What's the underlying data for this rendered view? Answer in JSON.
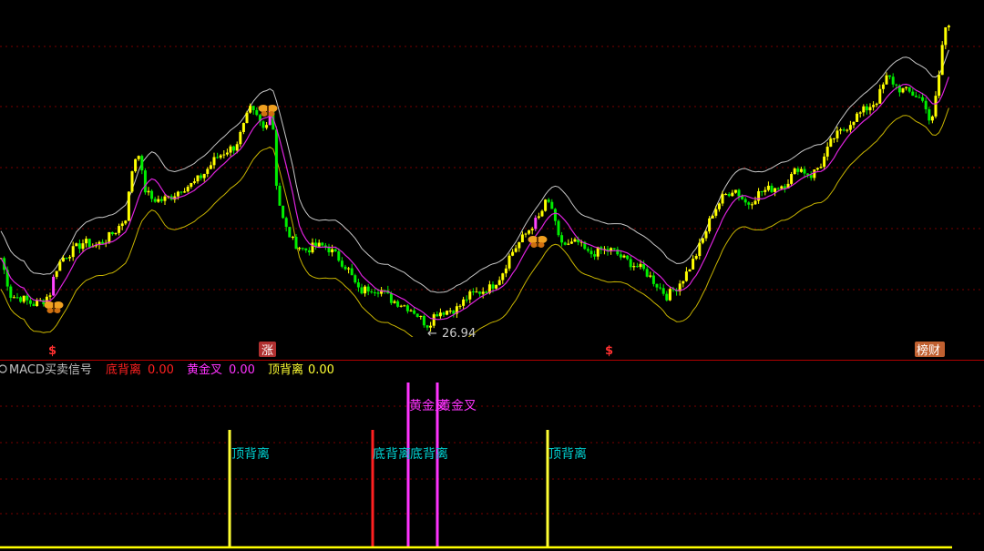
{
  "colors": {
    "background": "#000000",
    "rise": "#ffff00",
    "fall": "#00ee00",
    "signal_bar": "#ff44ff",
    "upper_band": "#c8c8c8",
    "mid_line": "#dd22dd",
    "lower_band": "#c8b400",
    "panel_divider": "#b00000",
    "grid": "#7a0000",
    "indicator_name": "#c0c0c0",
    "bottom_divergence": "#ff2020",
    "golden_cross": "#ff33ff",
    "top_divergence": "#ffff33",
    "bar_label": "#00d0d0",
    "marker_red": "#ff3030",
    "marker_badge_bg": "#b03030",
    "marker_badge_text": "#ffffff",
    "marker_right_bg": "#c06030"
  },
  "price_panel": {
    "low_callout": {
      "text": "26.94",
      "arrow": "←"
    },
    "butterfly_icon": "butterfly-icon",
    "markers": [
      {
        "text": "$",
        "style": "plain"
      },
      {
        "text": "涨",
        "style": "badge"
      },
      {
        "text": "$",
        "style": "plain"
      },
      {
        "text": "榜财",
        "style": "badge-right"
      }
    ]
  },
  "indicator_panel": {
    "name": "MACD买卖信号",
    "legend": [
      {
        "label": "底背离",
        "value": "0.00",
        "color": "#ff2020"
      },
      {
        "label": "黄金叉",
        "value": "0.00",
        "color": "#ff33ff"
      },
      {
        "label": "顶背离",
        "value": "0.00",
        "color": "#ffff33"
      }
    ],
    "signal_labels": [
      "顶背离",
      "底背离",
      "黄金叉",
      "底背离",
      "黄金叉",
      "顶背离"
    ]
  },
  "chart_data": [
    {
      "type": "candlestick",
      "title": "",
      "price_reference": {
        "label": "26.94",
        "value": 26.94
      },
      "points": [
        [
          0,
          40
        ],
        [
          12,
          20
        ],
        [
          24,
          19
        ],
        [
          36,
          16
        ],
        [
          48,
          18
        ],
        [
          56,
          22
        ],
        [
          60,
          32
        ],
        [
          68,
          38
        ],
        [
          80,
          42
        ],
        [
          92,
          46
        ],
        [
          104,
          44
        ],
        [
          116,
          47
        ],
        [
          128,
          52
        ],
        [
          138,
          58
        ],
        [
          146,
          84
        ],
        [
          152,
          90
        ],
        [
          158,
          72
        ],
        [
          166,
          67
        ],
        [
          176,
          66
        ],
        [
          188,
          68
        ],
        [
          200,
          72
        ],
        [
          212,
          74
        ],
        [
          224,
          79
        ],
        [
          236,
          86
        ],
        [
          248,
          90
        ],
        [
          258,
          92
        ],
        [
          266,
          100
        ],
        [
          274,
          110
        ],
        [
          282,
          106
        ],
        [
          290,
          100
        ],
        [
          298,
          114
        ],
        [
          304,
          70
        ],
        [
          312,
          54
        ],
        [
          322,
          46
        ],
        [
          334,
          42
        ],
        [
          346,
          44
        ],
        [
          358,
          44
        ],
        [
          370,
          39
        ],
        [
          382,
          33
        ],
        [
          394,
          22
        ],
        [
          406,
          24
        ],
        [
          418,
          23
        ],
        [
          430,
          18
        ],
        [
          442,
          16
        ],
        [
          454,
          13
        ],
        [
          464,
          8
        ],
        [
          470,
          6
        ],
        [
          478,
          12
        ],
        [
          490,
          13
        ],
        [
          502,
          14
        ],
        [
          514,
          20
        ],
        [
          526,
          22
        ],
        [
          538,
          24
        ],
        [
          550,
          30
        ],
        [
          560,
          40
        ],
        [
          572,
          47
        ],
        [
          584,
          54
        ],
        [
          592,
          58
        ],
        [
          600,
          66
        ],
        [
          606,
          62
        ],
        [
          612,
          48
        ],
        [
          622,
          44
        ],
        [
          634,
          46
        ],
        [
          646,
          40
        ],
        [
          660,
          42
        ],
        [
          672,
          42
        ],
        [
          684,
          38
        ],
        [
          696,
          35
        ],
        [
          708,
          32
        ],
        [
          720,
          26
        ],
        [
          732,
          20
        ],
        [
          742,
          24
        ],
        [
          752,
          30
        ],
        [
          762,
          38
        ],
        [
          772,
          48
        ],
        [
          782,
          60
        ],
        [
          794,
          68
        ],
        [
          806,
          72
        ],
        [
          820,
          64
        ],
        [
          834,
          70
        ],
        [
          848,
          72
        ],
        [
          862,
          74
        ],
        [
          876,
          82
        ],
        [
          890,
          78
        ],
        [
          902,
          84
        ],
        [
          914,
          96
        ],
        [
          926,
          100
        ],
        [
          938,
          106
        ],
        [
          950,
          110
        ],
        [
          962,
          114
        ],
        [
          974,
          126
        ],
        [
          986,
          120
        ],
        [
          998,
          118
        ],
        [
          1008,
          116
        ],
        [
          1016,
          112
        ],
        [
          1022,
          101
        ],
        [
          1030,
          124
        ],
        [
          1036,
          148
        ],
        [
          1044,
          152
        ]
      ]
    },
    {
      "type": "bar",
      "title": "MACD买卖信号",
      "series": [
        {
          "name": "底背离",
          "value": 0.0
        },
        {
          "name": "黄金叉",
          "value": 0.0
        },
        {
          "name": "顶背离",
          "value": 0.0
        }
      ],
      "signals": [
        {
          "label": "顶背离",
          "series": "顶背离"
        },
        {
          "label": "底背离",
          "series": "底背离"
        },
        {
          "label": "黄金叉",
          "series": "黄金叉"
        },
        {
          "label": "底背离",
          "series": "黄金叉"
        },
        {
          "label": "黄金叉",
          "series": "黄金叉"
        },
        {
          "label": "顶背离",
          "series": "顶背离"
        }
      ]
    }
  ]
}
